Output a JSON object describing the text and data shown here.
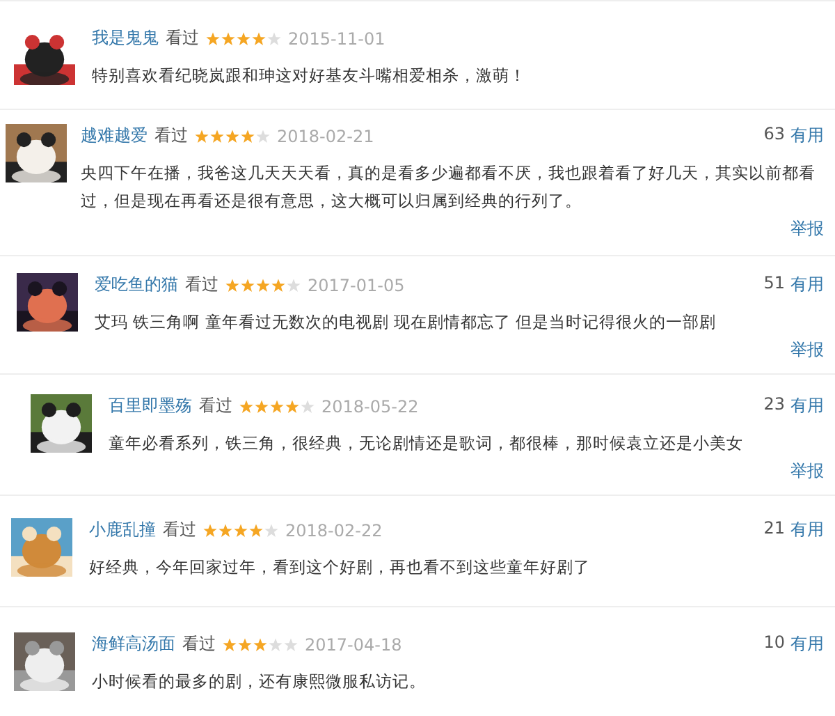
{
  "reviews": [
    {
      "user": "我是鬼鬼",
      "status": "看过",
      "stars": 4,
      "date": "2015-11-01",
      "text": "特别喜欢看纪晓岚跟和珅这对好基友斗嘴相爱相杀，激萌！"
    },
    {
      "user": "越难越爱",
      "status": "看过",
      "stars": 4,
      "date": "2018-02-21",
      "votes": "63",
      "useful": "有用",
      "text": "央四下午在播，我爸这几天天天看，真的是看多少遍都看不厌，我也跟着看了好几天，其实以前都看过，但是现在再看还是很有意思，这大概可以归属到经典的行列了。",
      "report": "举报"
    },
    {
      "user": "爱吃鱼的猫",
      "status": "看过",
      "stars": 4,
      "date": "2017-01-05",
      "votes": "51",
      "useful": "有用",
      "text": "艾玛 铁三角啊 童年看过无数次的电视剧 现在剧情都忘了 但是当时记得很火的一部剧",
      "report": "举报"
    },
    {
      "user": "百里即墨殇",
      "status": "看过",
      "stars": 4,
      "date": "2018-05-22",
      "votes": "23",
      "useful": "有用",
      "text": "童年必看系列，铁三角，很经典，无论剧情还是歌词，都很棒，那时候袁立还是小美女",
      "report": "举报"
    },
    {
      "user": "小鹿乱撞",
      "status": "看过",
      "stars": 4,
      "date": "2018-02-22",
      "votes": "21",
      "useful": "有用",
      "text": "好经典，今年回家过年，看到这个好剧，再也看不到这些童年好剧了"
    },
    {
      "user": "海鲜高汤面",
      "status": "看过",
      "stars": 3,
      "date": "2017-04-18",
      "votes": "10",
      "useful": "有用",
      "text": "小时候看的最多的剧，还有康熙微服私访记。"
    }
  ]
}
